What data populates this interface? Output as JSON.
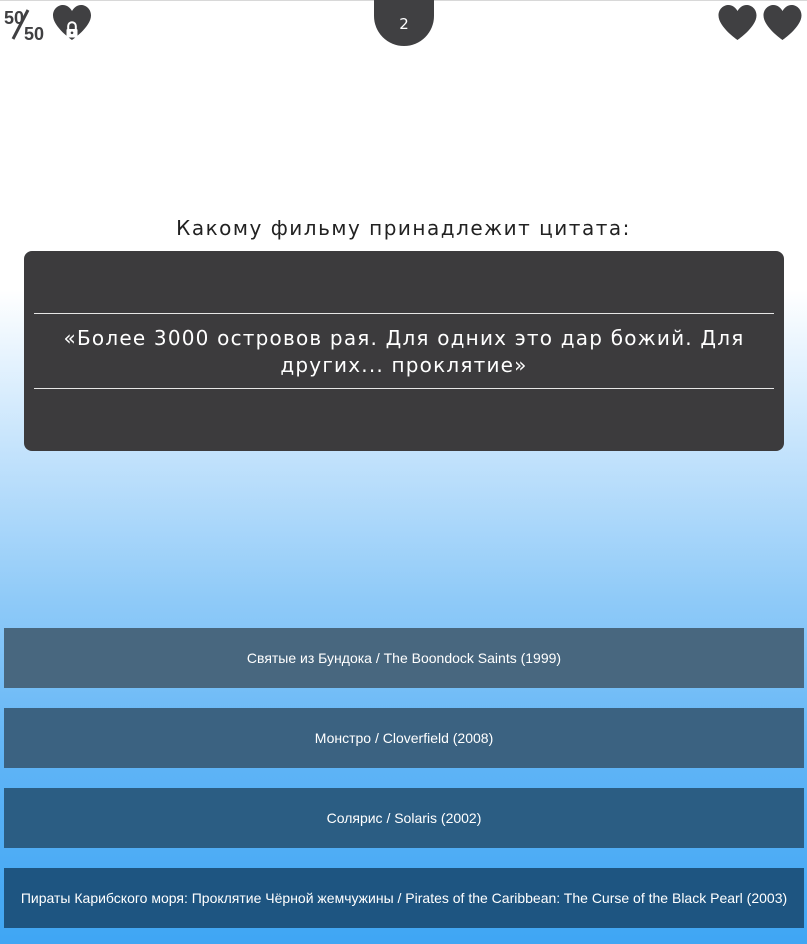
{
  "header": {
    "lifeline_5050_icon": "fifty-fifty-icon",
    "lifeline_heart_icon": "heart-lock-icon",
    "question_number": "2",
    "lives": [
      {
        "icon": "heart-icon"
      },
      {
        "icon": "heart-icon"
      }
    ]
  },
  "question": {
    "label": "Какому фильму принадлежит цитата:",
    "quote": "«Более 3000 островов рая. Для одних это дар божий. Для других... проклятие»"
  },
  "answers": [
    {
      "label": "Святые из Бундока / The Boondock Saints (1999)"
    },
    {
      "label": "Монстро / Cloverfield (2008)"
    },
    {
      "label": "Солярис / Solaris (2002)"
    },
    {
      "label": "Пираты Карибского моря: Проклятие Чёрной жемчужины / Pirates of the Caribbean: The Curse of the Black Pearl (2003)"
    }
  ],
  "colors": {
    "icon": "#404042",
    "quote_box": "#3c3b3d",
    "answer_backgrounds": [
      "#48677f",
      "#3b6281",
      "#2b5d83",
      "#1e5581"
    ]
  }
}
